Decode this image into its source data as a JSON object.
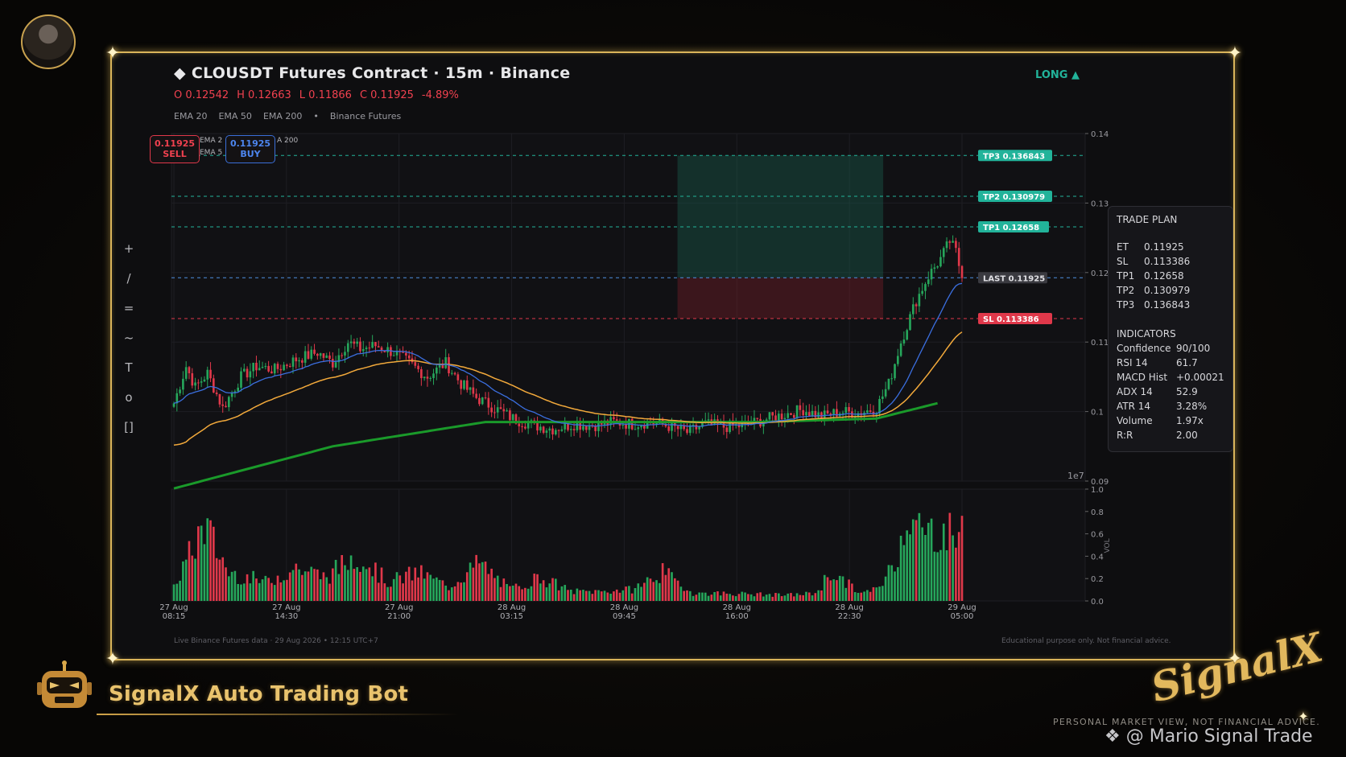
{
  "header": {
    "title": "◆  CLOUSDT Futures Contract  ·  15m  ·  Binance",
    "ohlc": {
      "o": "O 0.12542",
      "h": "H 0.12663",
      "l": "L 0.11866",
      "c": "C 0.11925",
      "chg": "-4.89%"
    },
    "emas": [
      "EMA 20",
      "EMA 50",
      "EMA 200",
      "•",
      "Binance Futures"
    ],
    "direction": "LONG ▲"
  },
  "toolbar": {
    "items": [
      "+",
      "/",
      "=",
      "~",
      "T",
      "o",
      "[]"
    ]
  },
  "order_buttons": {
    "sell_price": "0.11925",
    "sell_label": "SELL",
    "buy_price": "0.11925",
    "buy_label": "BUY",
    "legend": [
      "EMA 2",
      "EMA 5",
      "A 200"
    ]
  },
  "levels": {
    "tp3": {
      "label": "TP3  0.136843",
      "value": 0.136843
    },
    "tp2": {
      "label": "TP2  0.130979",
      "value": 0.130979
    },
    "tp1": {
      "label": "TP1  0.12658",
      "value": 0.12658
    },
    "last": {
      "label": "LAST  0.11925",
      "value": 0.11925
    },
    "sl": {
      "label": "SL  0.113386",
      "value": 0.113386
    }
  },
  "trade_plan": {
    "heading": "TRADE PLAN",
    "rows": [
      [
        "ET",
        "0.11925"
      ],
      [
        "SL",
        "0.113386"
      ],
      [
        "TP1",
        "0.12658"
      ],
      [
        "TP2",
        "0.130979"
      ],
      [
        "TP3",
        "0.136843"
      ]
    ],
    "ind_heading": "INDICATORS",
    "indicators": [
      [
        "Confidence",
        "90/100"
      ],
      [
        "RSI 14",
        "61.7"
      ],
      [
        "MACD Hist",
        "+0.00021"
      ],
      [
        "ADX 14",
        "52.9"
      ],
      [
        "ATR 14",
        "3.28%"
      ],
      [
        "Volume",
        "1.97x"
      ],
      [
        "R:R",
        "2.00"
      ]
    ]
  },
  "chart_data": {
    "type": "candlestick",
    "price_axis": {
      "ticks": [
        "0.14",
        "0.13",
        "0.12",
        "0.11",
        "0.1",
        "0.09"
      ],
      "values": [
        0.14,
        0.13,
        0.12,
        0.11,
        0.1,
        0.09
      ],
      "ylim": [
        0.09,
        0.14
      ],
      "offset_label": "1e7"
    },
    "volume_axis": {
      "ticks": [
        "1.0",
        "0.8",
        "0.6",
        "0.4",
        "0.2",
        "0.0"
      ],
      "values": [
        1.0,
        0.8,
        0.6,
        0.4,
        0.2,
        0.0
      ],
      "label": "VOL"
    },
    "time_ticks": [
      [
        "27 Aug",
        "08:15"
      ],
      [
        "27 Aug",
        "14:30"
      ],
      [
        "27 Aug",
        "21:00"
      ],
      [
        "28 Aug",
        "03:15"
      ],
      [
        "28 Aug",
        "09:45"
      ],
      [
        "28 Aug",
        "16:00"
      ],
      [
        "28 Aug",
        "22:30"
      ],
      [
        "29 Aug",
        "05:00"
      ]
    ],
    "ema_colors": {
      "ema20": "#3b6fe0",
      "ema50": "#f2a93b",
      "ema200": "#1a9a2a"
    },
    "up_color": "#26a65b",
    "down_color": "#e0384a",
    "close_anchors": [
      [
        0,
        0.1012
      ],
      [
        4,
        0.1065
      ],
      [
        7,
        0.1035
      ],
      [
        11,
        0.1055
      ],
      [
        16,
        0.1005
      ],
      [
        22,
        0.105
      ],
      [
        27,
        0.1065
      ],
      [
        33,
        0.106
      ],
      [
        40,
        0.1075
      ],
      [
        47,
        0.1085
      ],
      [
        52,
        0.107
      ],
      [
        57,
        0.11
      ],
      [
        61,
        0.109
      ],
      [
        66,
        0.1095
      ],
      [
        72,
        0.1085
      ],
      [
        77,
        0.107
      ],
      [
        83,
        0.105
      ],
      [
        89,
        0.107
      ],
      [
        94,
        0.104
      ],
      [
        99,
        0.102
      ],
      [
        105,
        0.1005
      ],
      [
        111,
        0.099
      ],
      [
        118,
        0.098
      ],
      [
        124,
        0.0975
      ],
      [
        131,
        0.0982
      ],
      [
        137,
        0.098
      ],
      [
        144,
        0.0985
      ],
      [
        150,
        0.0982
      ],
      [
        156,
        0.0985
      ],
      [
        163,
        0.0978
      ],
      [
        168,
        0.097
      ],
      [
        174,
        0.0982
      ],
      [
        180,
        0.0978
      ],
      [
        187,
        0.098
      ],
      [
        193,
        0.0988
      ],
      [
        199,
        0.0995
      ],
      [
        206,
        0.1003
      ],
      [
        212,
        0.0993
      ],
      [
        218,
        0.1
      ],
      [
        224,
        0.0998
      ],
      [
        230,
        0.1005
      ],
      [
        234,
        0.104
      ],
      [
        238,
        0.11
      ],
      [
        243,
        0.116
      ],
      [
        247,
        0.1195
      ],
      [
        251,
        0.122
      ],
      [
        254,
        0.1245
      ],
      [
        256,
        0.123
      ],
      [
        258,
        0.1192
      ]
    ],
    "volume_anchors": [
      [
        0,
        0.15
      ],
      [
        10,
        0.8
      ],
      [
        18,
        0.3
      ],
      [
        30,
        0.2
      ],
      [
        40,
        0.35
      ],
      [
        50,
        0.25
      ],
      [
        60,
        0.5
      ],
      [
        70,
        0.2
      ],
      [
        80,
        0.3
      ],
      [
        90,
        0.15
      ],
      [
        100,
        0.4
      ],
      [
        110,
        0.12
      ],
      [
        120,
        0.25
      ],
      [
        130,
        0.1
      ],
      [
        140,
        0.1
      ],
      [
        150,
        0.12
      ],
      [
        160,
        0.3
      ],
      [
        170,
        0.08
      ],
      [
        180,
        0.08
      ],
      [
        190,
        0.07
      ],
      [
        200,
        0.06
      ],
      [
        210,
        0.08
      ],
      [
        215,
        0.3
      ],
      [
        225,
        0.08
      ],
      [
        230,
        0.12
      ],
      [
        236,
        0.4
      ],
      [
        240,
        0.95
      ],
      [
        245,
        0.7
      ],
      [
        250,
        0.75
      ],
      [
        255,
        0.7
      ],
      [
        258,
        0.75
      ]
    ],
    "candles": 259
  },
  "footer": {
    "left": "Live Binance Futures data  ·  29 Aug 2026 • 12:15 UTC+7",
    "right": "Educational purpose only. Not financial advice."
  },
  "branding": {
    "bot_name": "SignalX Auto Trading Bot",
    "logo_text": "SignalX",
    "tagline": "PERSONAL MARKET VIEW, NOT FINANCIAL ADVICE.",
    "watermark": "❖ @ Mario Signal Trade"
  }
}
